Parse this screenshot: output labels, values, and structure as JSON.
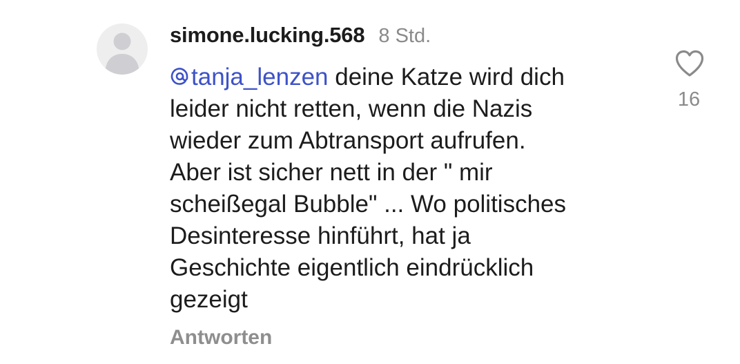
{
  "comment": {
    "username": "simone.lucking.568",
    "timestamp": "8 Std.",
    "mention": "tanja_lenzen",
    "text_lines": [
      " deine Katze wird dich",
      "leider nicht retten, wenn die Nazis",
      "wieder zum Abtransport aufrufen.",
      "Aber ist sicher nett in der \" mir",
      "scheißegal Bubble\" ... Wo politisches",
      "Desinteresse hinführt, hat ja",
      "Geschichte eigentlich eindrücklich",
      "gezeigt"
    ],
    "reply_label": "Antworten",
    "like_count": "16"
  },
  "icons": {
    "avatar": "default-user-avatar",
    "mention": "mention-at-icon",
    "like": "heart-outline-icon"
  },
  "colors": {
    "mention": "#3d52c8",
    "muted": "#8a8a8a",
    "text": "#1c1c1c",
    "avatar_bg": "#eeeeef"
  }
}
